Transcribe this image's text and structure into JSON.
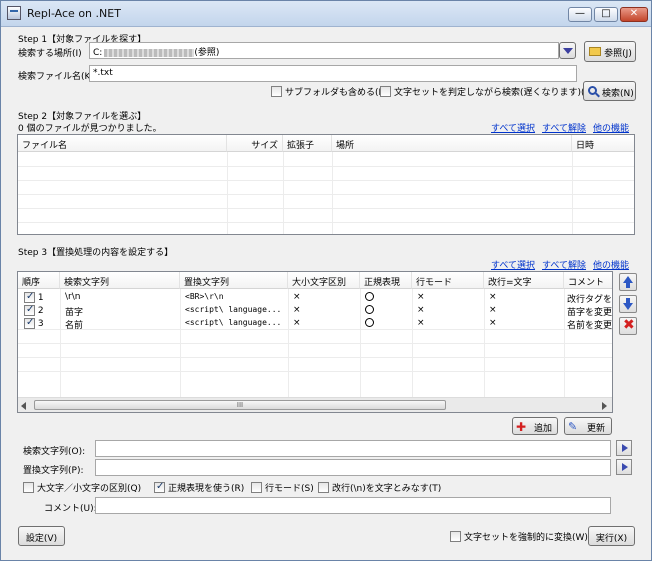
{
  "window": {
    "title": "Repl-Ace on .NET",
    "min": "—",
    "max": "□",
    "close": "✕"
  },
  "step1": {
    "heading": "Step 1【対象ファイルを探す】",
    "location_label": "検索する場所(I)",
    "location_value": "C:",
    "location_value_tail": "(参照)",
    "browse_button": "参照(J)",
    "filename_label": "検索ファイル名(K)",
    "filename_value": "*.txt",
    "include_subfolders": "サブフォルダも含める(L)",
    "detect_charset": "文字セットを判定しながら検索(遅くなります)(M)",
    "search_button": "検索(N)"
  },
  "step2": {
    "heading": "Step 2【対象ファイルを選ぶ】",
    "status": "0 個のファイルが見つかりました。",
    "links": [
      "すべて選択",
      "すべて解除",
      "他の機能"
    ],
    "columns": [
      "ファイル名",
      "サイズ",
      "拡張子",
      "場所",
      "日時"
    ]
  },
  "step3": {
    "heading": "Step 3【置換処理の内容を設定する】",
    "links": [
      "すべて選択",
      "すべて解除",
      "他の機能"
    ],
    "columns": [
      "順序",
      "検索文字列",
      "置換文字列",
      "大小文字区別",
      "正規表現",
      "行モード",
      "改行=文字",
      "コメント"
    ],
    "rows": [
      {
        "checked": true,
        "order": "1",
        "search": "\\r\\n",
        "replace": "<BR>\\r\\n",
        "case": "×",
        "regex": "○",
        "line": "×",
        "newline": "×",
        "comment": "改行タグを"
      },
      {
        "checked": true,
        "order": "2",
        "search": "苗字",
        "replace": "<script\\ language...",
        "case": "×",
        "regex": "○",
        "line": "×",
        "newline": "×",
        "comment": "苗字を変更"
      },
      {
        "checked": true,
        "order": "3",
        "search": "名前",
        "replace": "<script\\ language...",
        "case": "×",
        "regex": "○",
        "line": "×",
        "newline": "×",
        "comment": "名前を変更"
      }
    ],
    "scroll_grip": "III",
    "add_button": "追加",
    "update_button": "更新",
    "search_label": "検索文字列(O):",
    "replace_label": "置換文字列(P):",
    "search_value": "",
    "replace_value": "",
    "opt_case": "大文字／小文字の区別(Q)",
    "opt_regex": "正規表現を使う(R)",
    "opt_line": "行モード(S)",
    "opt_newline": "改行(\\n)を文字とみなす(T)",
    "comment_label": "コメント(U):",
    "comment_value": ""
  },
  "footer": {
    "settings_button": "設定(V)",
    "force_charset": "文字セットを強制的に変換(W)",
    "run_button": "実行(X)"
  }
}
